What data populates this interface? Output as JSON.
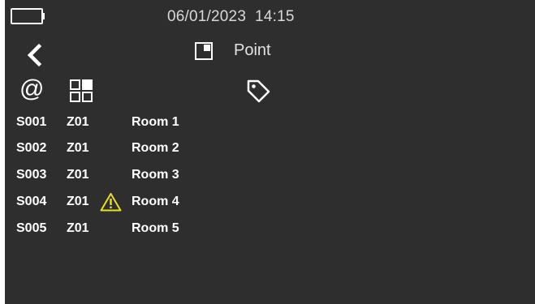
{
  "status": {
    "datetime": "06/01/2023  14:15",
    "battery_icon": "battery-empty-icon"
  },
  "header": {
    "back_icon": "chevron-left-icon",
    "title_icon": "point-square-icon",
    "title": "Point"
  },
  "columns": {
    "address_symbol": "@",
    "zone_icon": "grid-squares-icon",
    "label_icon": "tag-icon"
  },
  "rows": [
    {
      "id": "S001",
      "zone": "Z01",
      "room": "Room 1",
      "warning": false
    },
    {
      "id": "S002",
      "zone": "Z01",
      "room": "Room 2",
      "warning": false
    },
    {
      "id": "S003",
      "zone": "Z01",
      "room": "Room 3",
      "warning": false
    },
    {
      "id": "S004",
      "zone": "Z01",
      "room": "Room 4",
      "warning": true
    },
    {
      "id": "S005",
      "zone": "Z01",
      "room": "Room 5",
      "warning": false
    }
  ],
  "colors": {
    "background": "#2e2e2e",
    "text": "#ffffff",
    "warning": "#e8e020"
  }
}
